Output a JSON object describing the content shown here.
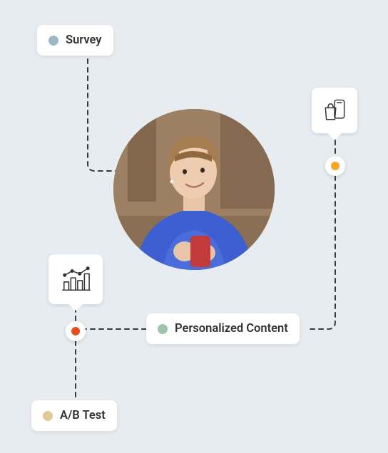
{
  "nodes": {
    "survey": {
      "label": "Survey",
      "dot_color": "#9CB8C6"
    },
    "personalized": {
      "label": "Personalized Content",
      "dot_color": "#9EC4AB"
    },
    "abtest": {
      "label": "A/B Test",
      "dot_color": "#E5C797"
    }
  },
  "waypoints": {
    "right": {
      "color": "#F6A623"
    },
    "left": {
      "color": "#E84E1B"
    }
  },
  "icons": {
    "shopping": "shopping-bag-phone-icon",
    "analytics": "bar-chart-trend-icon"
  },
  "style": {
    "dash_color": "#3a3a3a",
    "background": "#e7ecf1"
  }
}
